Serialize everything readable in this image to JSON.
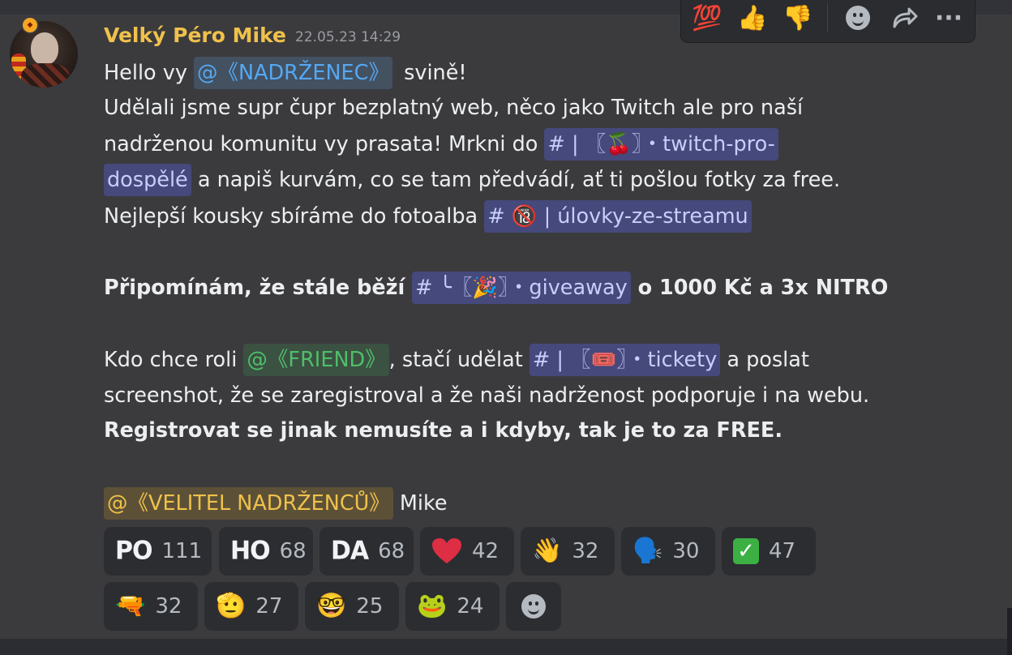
{
  "message": {
    "author": "Velký Péro Mike",
    "timestamp": "22.05.23 14:29",
    "line1": {
      "prefix": "Hello vy ",
      "mention": "@《NADRŽENEC》",
      "suffix": " svině!"
    },
    "line2": "Udělali jsme supr čupr bezplatný web, něco jako Twitch ale pro naší",
    "line3": {
      "prefix": "nadrženou komunitu vy prasata! Mrkni do ",
      "channel_part1": "#  |  〖🍒〗・twitch-pro-"
    },
    "line4": {
      "channel_part2": "dospělé",
      "suffix": " a napiš kurvám, co se tam předvádí, ať ti pošlou fotky za free."
    },
    "line5": {
      "prefix": "Nejlepší kousky sbíráme do fotoalba ",
      "channel": "# 🔞 | úlovky-ze-streamu"
    },
    "line6": {
      "prefix": "Připomínám, že stále běží ",
      "channel": "#  ╰〖🎉〗・giveaway",
      "suffix": " o 1000 Kč a 3x NITRO"
    },
    "line7": {
      "prefix": "Kdo chce roli ",
      "mention": "@《FRIEND》",
      "middle": ", stačí udělat ",
      "channel": "#  |  〖🎟️〗・tickety",
      "suffix": " a poslat"
    },
    "line8": "screenshot, že se zaregistroval a že naši nadrženost podporuje i na webu.",
    "line9": "Registrovat se jinak nemusíte a i kdyby, tak je to za FREE.",
    "line10": {
      "mention": "@《VELITEL NADRŽENCŮ》",
      "suffix": " Mike"
    }
  },
  "toolbar": {
    "items": [
      "💯",
      "👍",
      "👎",
      "add-reaction",
      "reply",
      "more"
    ],
    "more_label": "···"
  },
  "reactions": [
    {
      "emoji": "PO",
      "count": "111",
      "kind": "text"
    },
    {
      "emoji": "HO",
      "count": "68",
      "kind": "text"
    },
    {
      "emoji": "DA",
      "count": "68",
      "kind": "text"
    },
    {
      "emoji": "❤️",
      "count": "42",
      "kind": "unicode"
    },
    {
      "emoji": "👋",
      "count": "32",
      "kind": "unicode"
    },
    {
      "emoji": "🗣️",
      "count": "30",
      "kind": "unicode"
    },
    {
      "emoji": "✓",
      "count": "47",
      "kind": "check"
    },
    {
      "emoji": "🔫",
      "count": "32",
      "kind": "unicode"
    },
    {
      "emoji": "🫡",
      "count": "27",
      "kind": "unicode"
    },
    {
      "emoji": "🤓",
      "count": "25",
      "kind": "unicode"
    },
    {
      "emoji": "🐸",
      "count": "24",
      "kind": "unicode"
    }
  ],
  "colors": {
    "username": "#f0c14b",
    "mention_blue": "#55a8f2",
    "mention_green": "#4fbe6a",
    "mention_gold": "#f0c14b",
    "channel": "#c9cdfb"
  }
}
